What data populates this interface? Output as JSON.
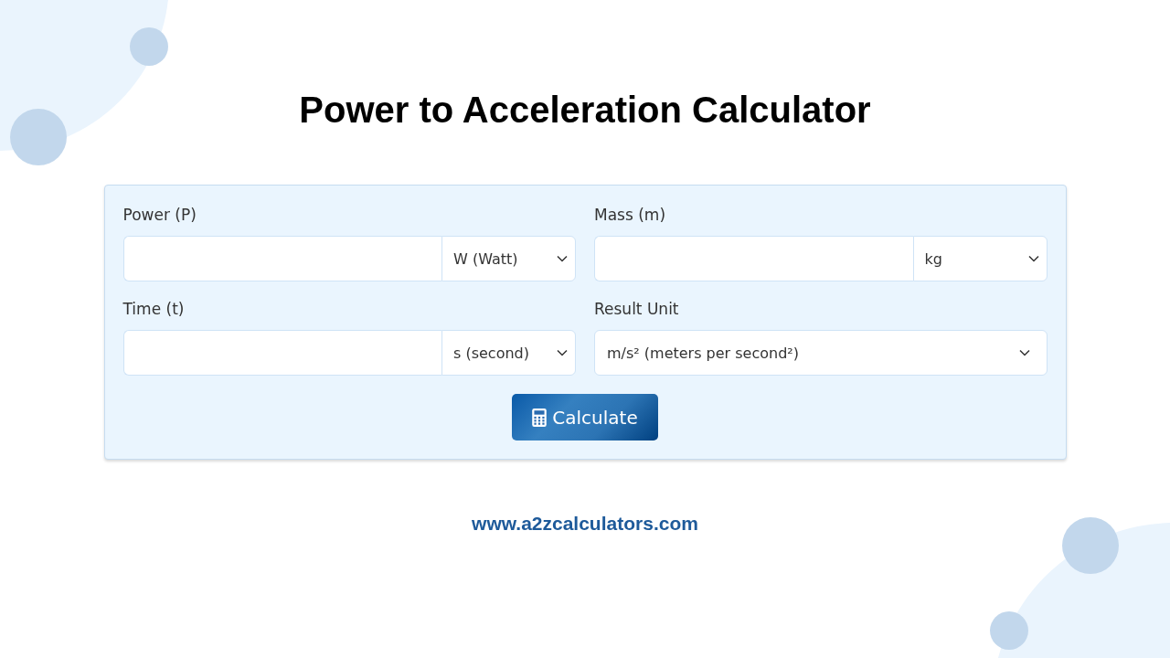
{
  "title": "Power to Acceleration Calculator",
  "fields": [
    {
      "kind": "input-unit",
      "label": "Power (P)",
      "unit": "W (Watt)"
    },
    {
      "kind": "input-unit",
      "label": "Mass (m)",
      "unit": "kg"
    },
    {
      "kind": "input-unit",
      "label": "Time (t)",
      "unit": "s (second)"
    },
    {
      "kind": "select",
      "label": "Result Unit",
      "value": "m/s² (meters per second²)"
    }
  ],
  "button": {
    "label": "Calculate"
  },
  "footer": {
    "link": "www.a2zcalculators.com"
  }
}
